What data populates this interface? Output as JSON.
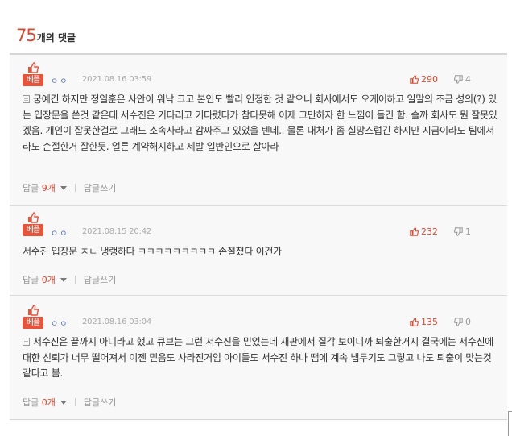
{
  "header": {
    "count": "75",
    "count_label": "개의 댓글"
  },
  "comments": [
    {
      "badge": "베플",
      "nick": "ㅇㅇ",
      "date": "2021.08.16 03:59",
      "likes": "290",
      "dislikes": "4",
      "text": "궁예긴 하지만 정일훈은 사안이 워낙 크고 본인도 빨리 인정한 것 같으니 회사에서도 오케이하고 일말의 조금 성의(?) 있는 입장문을 쓴것 같은데 서수진은 기다리고 기다렸다가 참다못해 이제 그만하자 한 느낌이 들긴 함. 솔까 회사도 뭔 잘못있겠음. 개인이 잘못한걸로 그래도 소속사라고 감싸주고 있었을 텐데.. 물론 대처가 좀 실망스럽긴 하지만 지금이라도 팀에서라도 손절한거 잘한듯. 얼른 계약해지하고 제발 일반인으로 살아라",
      "reply_label": "답글",
      "reply_count": "9개",
      "write_reply": "답글쓰기"
    },
    {
      "badge": "베플",
      "nick": "ㅇㅇ",
      "date": "2021.08.15 20:42",
      "likes": "232",
      "dislikes": "1",
      "text": "서수진 입장문 ㅈㄴ 냉랭하다 ㅋㅋㅋㅋㅋㅋㅋㅋㅋ 손절쳤다 이건가",
      "reply_label": "답글",
      "reply_count": "0개",
      "write_reply": "답글쓰기"
    },
    {
      "badge": "베플",
      "nick": "ㅇㅇ",
      "date": "2021.08.16 03:04",
      "likes": "135",
      "dislikes": "0",
      "text": "서수진은 끝까지 아니라고 했고 큐브는 그런 서수진을 믿었는데 재판에서 질각 보이니까 퇴출한거지 결국에는 서수진에 대한 신뢰가 너무 떨어져서 이젠 믿음도 사라진거임 아이들도 서수진 하나 땜에 계속 냅두기도 그렇고 나도 퇴출이 맞는것 같다고 봄.",
      "reply_label": "답글",
      "reply_count": "0개",
      "write_reply": "답글쓰기"
    }
  ],
  "colors": {
    "accent": "#e0442b",
    "badge": "#e8533c",
    "nick": "#5670b8",
    "item_bg": "#f8f8f8"
  }
}
